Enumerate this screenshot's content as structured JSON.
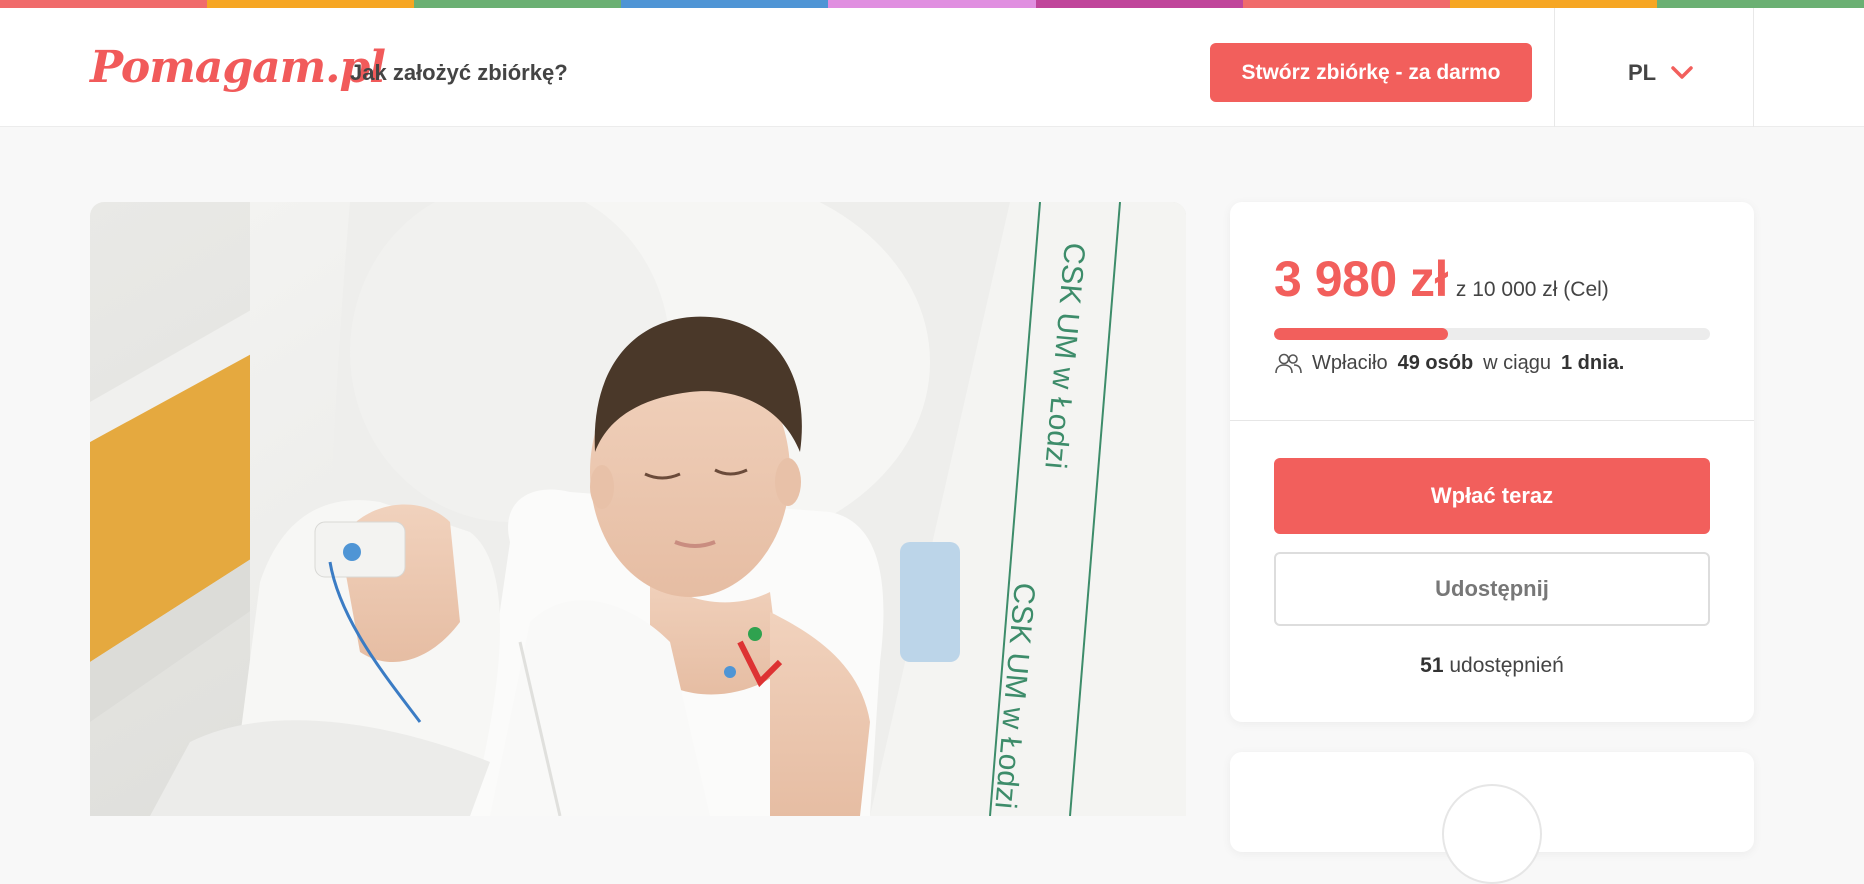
{
  "stripe_colors": [
    "#f06b6b",
    "#f6a623",
    "#6bb073",
    "#4f95d5",
    "#e08fe0",
    "#c0459a",
    "#f06b6b",
    "#f6a623",
    "#6bb073"
  ],
  "header": {
    "logo": "Pomagam.pl",
    "how_link": "Jak założyć zbiórkę?",
    "create_button": "Stwórz zbiórkę - za darmo",
    "language": "PL"
  },
  "campaign": {
    "raised": "3 980 zł",
    "goal_text": "z 10 000 zł (Cel)",
    "progress_fraction": 0.398,
    "donors_prefix": "Wpłaciło",
    "donors_count": "49 osób",
    "donors_middle": "w ciągu",
    "donors_days": "1 dnia.",
    "pay_button": "Wpłać teraz",
    "share_button": "Udostępnij",
    "shares_count": "51",
    "shares_label": "udostępnień"
  },
  "photo": {
    "hospital_text_1": "CSK UM w Łodzi",
    "hospital_text_2": "CSK UM w Łodzi"
  },
  "colors": {
    "accent": "#f25f5c"
  }
}
